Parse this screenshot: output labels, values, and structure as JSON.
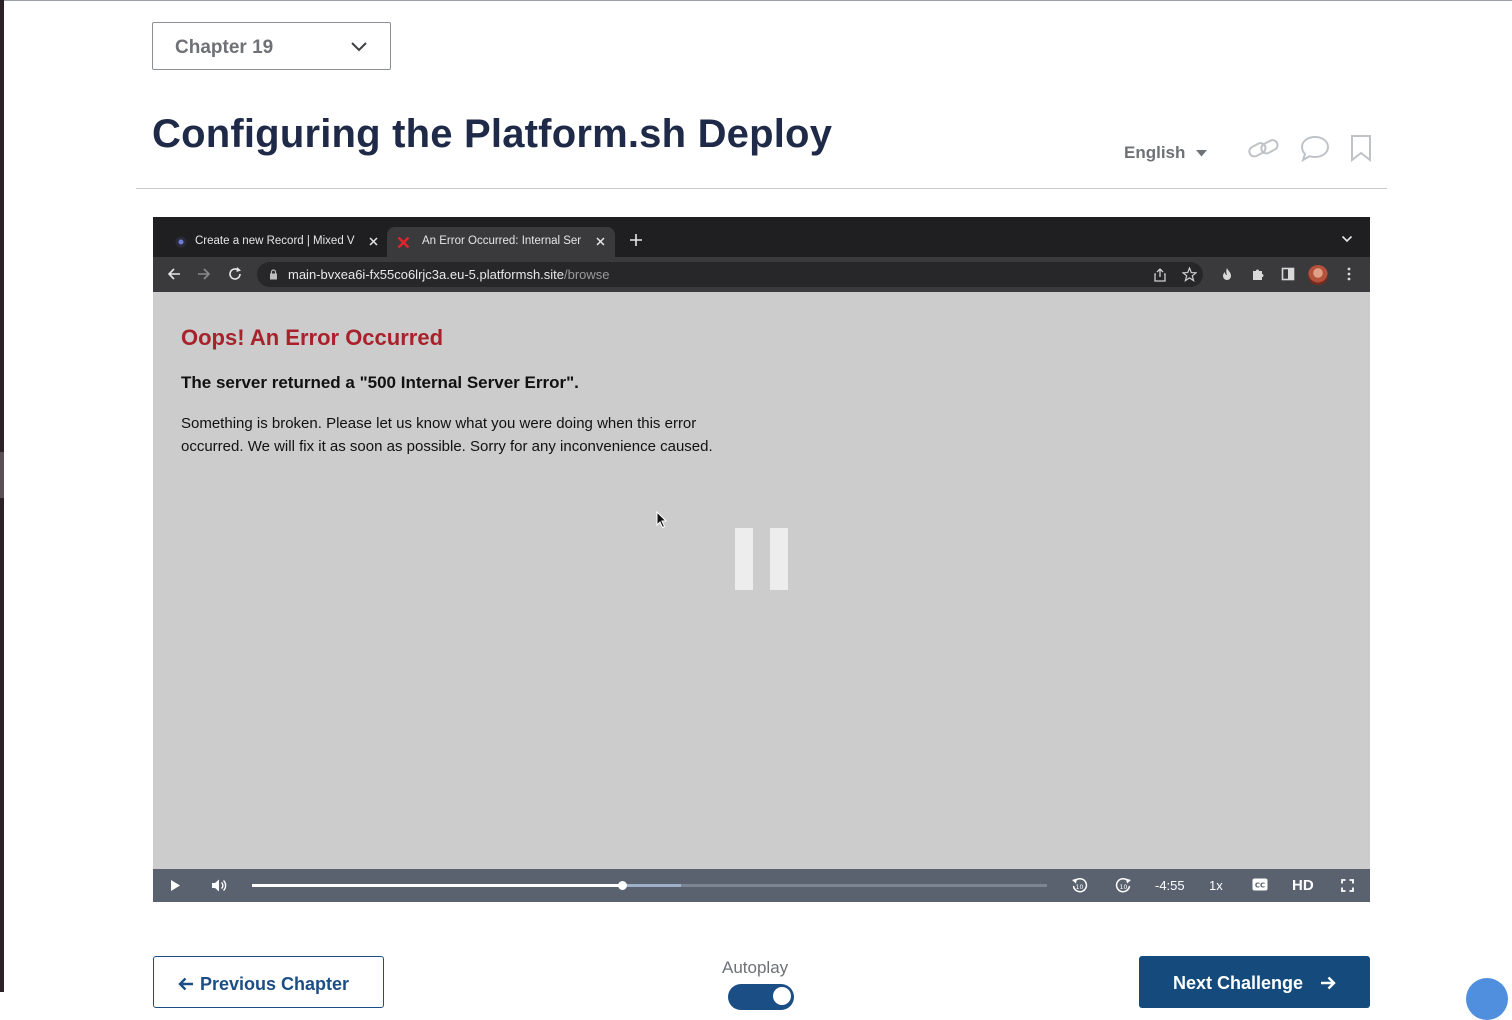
{
  "chapter_select": {
    "value": "Chapter 19"
  },
  "page_title": "Configuring the Platform.sh Deploy",
  "language": {
    "selected": "English"
  },
  "header_actions": [
    "link-icon",
    "comment-icon",
    "bookmark-icon"
  ],
  "browser": {
    "tabs": [
      {
        "title": "Create a new Record | Mixed Vi",
        "favicon": "app-favicon-icon",
        "active": false
      },
      {
        "title": "An Error Occurred: Internal Ser",
        "favicon": "error-x-icon",
        "active": true
      }
    ],
    "url": {
      "host": "main-bvxea6i-fx55co6lrjc3a.eu-5.platformsh.site",
      "path": "/browse"
    }
  },
  "error_page": {
    "title": "Oops! An Error Occurred",
    "subtitle": "The server returned a \"500 Internal Server Error\".",
    "body": "Something is broken. Please let us know what you were doing when this error occurred. We will fix it as soon as possible. Sorry for any inconvenience caused."
  },
  "video_controls": {
    "time_remaining": "-4:55",
    "speed": "1x",
    "quality": "HD",
    "played_fraction": 0.465,
    "buffered_fraction": 0.54
  },
  "navigation": {
    "previous_label": "Previous Chapter",
    "autoplay_label": "Autoplay",
    "autoplay_on": true,
    "next_label": "Next Challenge"
  },
  "colors": {
    "title": "#1e2a47",
    "error_red": "#a8222c",
    "primary_blue": "#144a7c"
  }
}
